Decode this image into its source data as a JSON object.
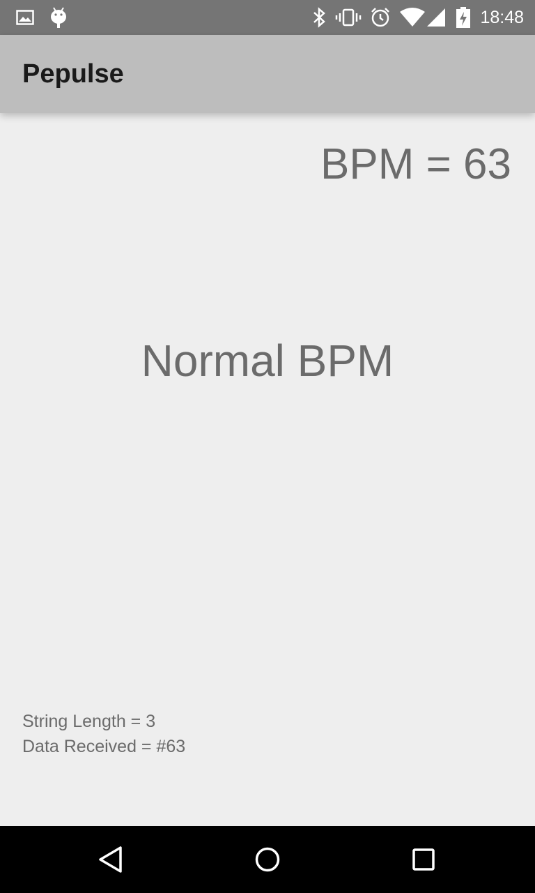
{
  "status_bar": {
    "time": "18:48",
    "icons": [
      "image-icon",
      "android-icon",
      "bluetooth-icon",
      "vibrate-icon",
      "alarm-icon",
      "wifi-icon",
      "signal-icon",
      "battery-charging-icon"
    ]
  },
  "app_bar": {
    "title": "Pepulse"
  },
  "main": {
    "bpm_text": "BPM = 63",
    "status_text": "Normal BPM",
    "string_length_text": "String Length = 3",
    "data_received_text": "Data Received = #63"
  },
  "nav_bar": {
    "icons": [
      "back-icon",
      "home-icon",
      "recents-icon"
    ]
  },
  "colors": {
    "status_bar": "#757575",
    "app_bar": "#bdbdbd",
    "background": "#eeeeee",
    "text_grey": "#6b6b6b",
    "nav_bar": "#000000"
  }
}
